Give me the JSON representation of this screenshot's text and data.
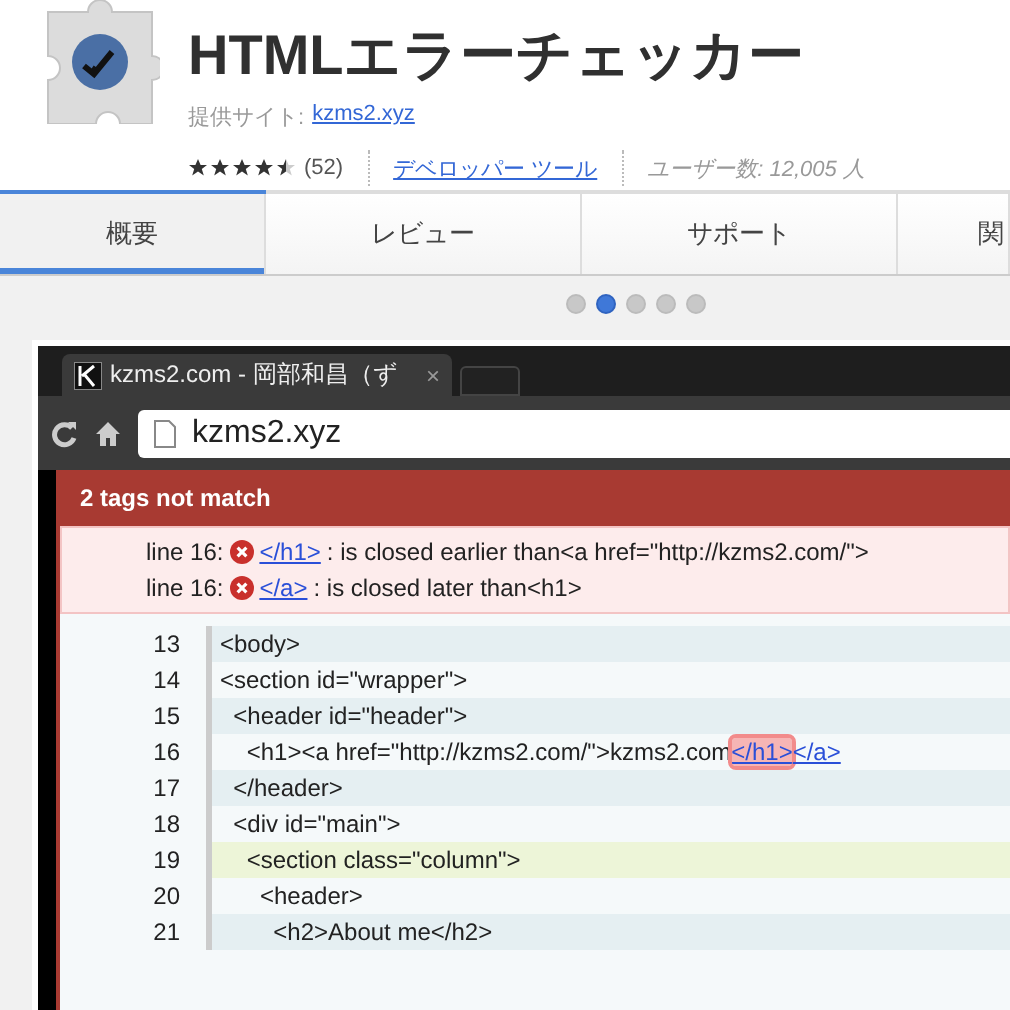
{
  "header": {
    "title": "HTMLエラーチェッカー",
    "provider_label": "提供サイト:",
    "provider_link": "kzms2.xyz",
    "stars": 4.5,
    "rating_count": "(52)",
    "category": "デベロッパー ツール",
    "users": "ユーザー数: 12,005 人"
  },
  "tabs": [
    {
      "label": "概要",
      "selected": true
    },
    {
      "label": "レビュー",
      "selected": false
    },
    {
      "label": "サポート",
      "selected": false
    },
    {
      "label": "関",
      "selected": false
    }
  ],
  "carousel": [
    {
      "selected": false
    },
    {
      "selected": true
    },
    {
      "selected": false
    },
    {
      "selected": false
    },
    {
      "selected": false
    }
  ],
  "screenshot": {
    "browser_tab": {
      "title": "kzms2.com - 岡部和昌（ず",
      "close": "×"
    },
    "address": "kzms2.xyz",
    "panel": {
      "title": "2 tags not match",
      "errors": [
        {
          "prefix": "line 16:",
          "tag": "</h1>",
          "message": ": is closed earlier than<a href=\"http://kzms2.com/\">"
        },
        {
          "prefix": "line 16:",
          "tag": "</a>",
          "message": ": is closed later than<h1>"
        }
      ],
      "lines": [
        {
          "number": "13",
          "highlighted": false,
          "parts": [
            {
              "kind": "text",
              "text": "<body>"
            }
          ]
        },
        {
          "number": "14",
          "highlighted": false,
          "parts": [
            {
              "kind": "text",
              "text": "<section id=\"wrapper\">"
            }
          ]
        },
        {
          "number": "15",
          "highlighted": false,
          "parts": [
            {
              "kind": "text",
              "text": "  <header id=\"header\">"
            }
          ]
        },
        {
          "number": "16",
          "highlighted": false,
          "parts": [
            {
              "kind": "text",
              "text": "    <h1><a href=\"http://kzms2.com/\">kzms2.com"
            },
            {
              "kind": "error-link",
              "text": "</h1>"
            },
            {
              "kind": "link",
              "text": "</a>"
            }
          ]
        },
        {
          "number": "17",
          "highlighted": false,
          "parts": [
            {
              "kind": "text",
              "text": "  </header>"
            }
          ]
        },
        {
          "number": "18",
          "highlighted": false,
          "parts": [
            {
              "kind": "text",
              "text": "  <div id=\"main\">"
            }
          ]
        },
        {
          "number": "19",
          "highlighted": true,
          "parts": [
            {
              "kind": "text",
              "text": "    <section class=\"column\">"
            }
          ]
        },
        {
          "number": "20",
          "highlighted": false,
          "parts": [
            {
              "kind": "text",
              "text": "      <header>"
            }
          ]
        },
        {
          "number": "21",
          "highlighted": false,
          "parts": [
            {
              "kind": "text",
              "text": "        <h2>About me</h2>"
            }
          ]
        }
      ]
    }
  }
}
